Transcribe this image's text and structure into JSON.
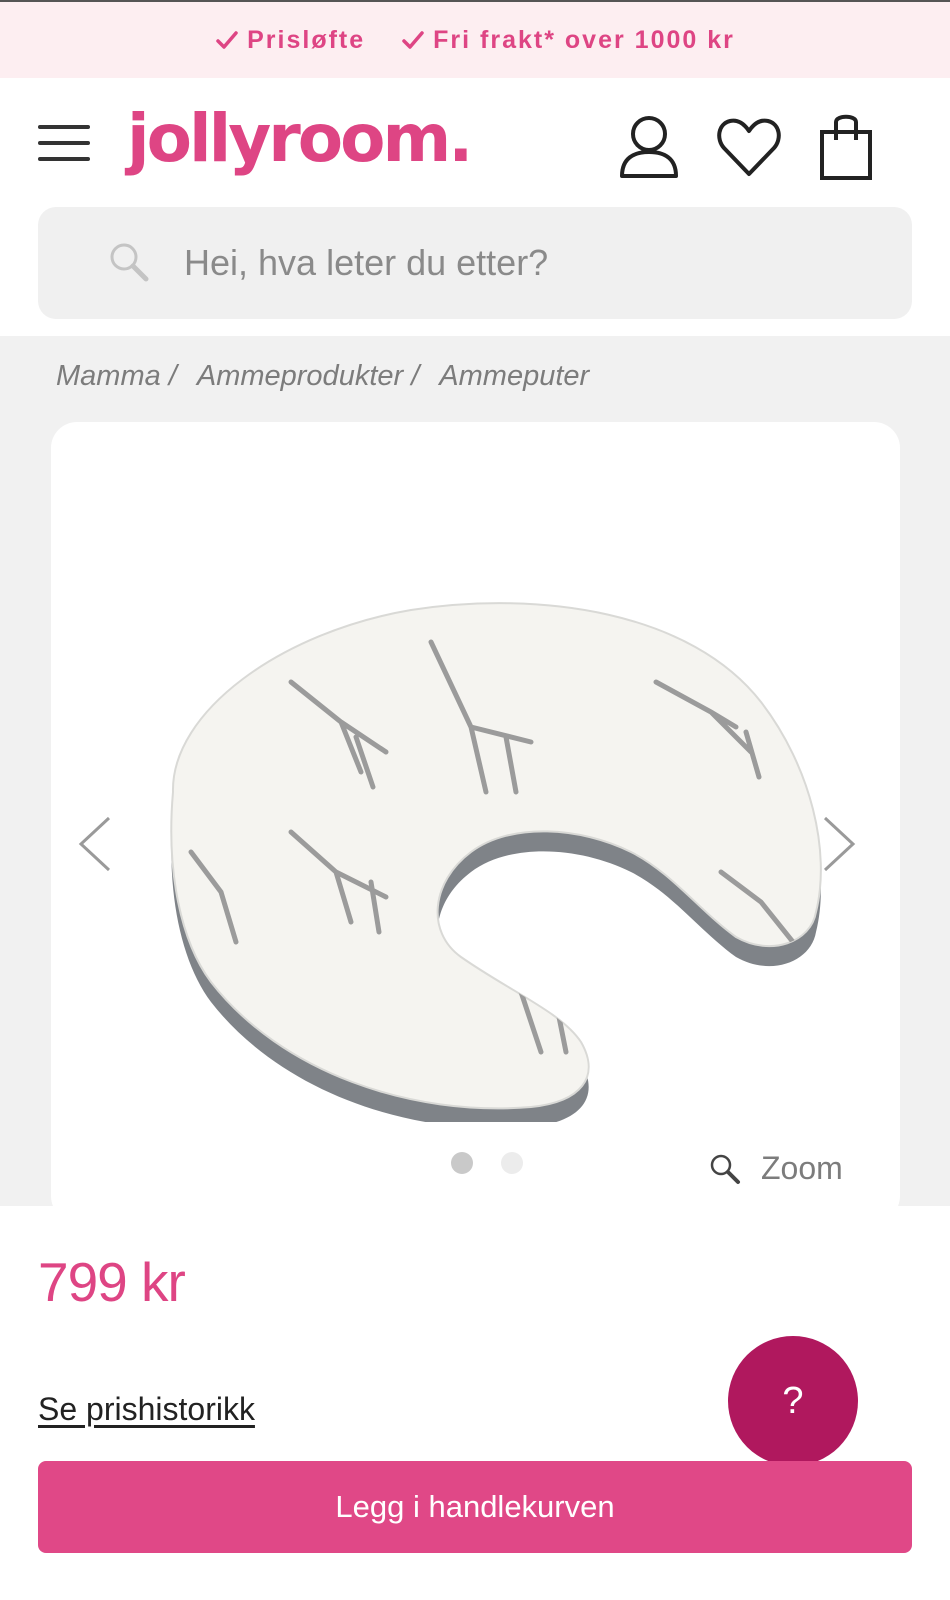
{
  "promo": {
    "items": [
      "Prisløfte",
      "Fri frakt* over 1000 kr"
    ]
  },
  "header": {
    "logo": "jollyroom.",
    "brand_color": "#de4584"
  },
  "search": {
    "placeholder": "Hei, hva leter du etter?"
  },
  "breadcrumb": [
    {
      "label": "Mamma",
      "sep": "/"
    },
    {
      "label": "Ammeprodukter",
      "sep": "/"
    },
    {
      "label": "Ammeputer",
      "sep": ""
    }
  ],
  "gallery": {
    "image_count": 2,
    "active_index": 0,
    "zoom_label": "Zoom"
  },
  "product": {
    "price": "799 kr",
    "price_history_link": "Se prishistorikk",
    "add_to_cart": "Legg i handlekurven"
  },
  "help": {
    "label": "?"
  },
  "icons": [
    "menu-icon",
    "user-icon",
    "heart-icon",
    "bag-icon",
    "search-icon",
    "check-icon",
    "chevron-left-icon",
    "chevron-right-icon",
    "zoom-icon"
  ]
}
